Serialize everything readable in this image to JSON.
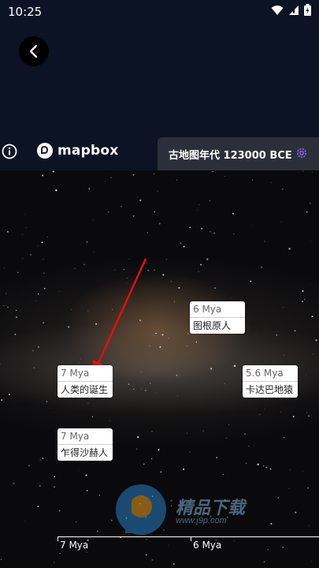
{
  "status_bar": {
    "time": "10:25"
  },
  "navigation": {
    "back_icon": "chevron-left-icon"
  },
  "map": {
    "info_icon": "info-icon",
    "provider": "mapbox",
    "era_label": "古地图年代 123000 BCE",
    "settings_icon": "gear-icon",
    "accent_color": "#8b5cf6"
  },
  "events": [
    {
      "date": "6 Mya",
      "name": "图根原人"
    },
    {
      "date": "7 Mya",
      "name": "人类的诞生"
    },
    {
      "date": "5.6 Mya",
      "name": "卡达巴地猿"
    },
    {
      "date": "7 Mya",
      "name": "乍得沙赫人"
    }
  ],
  "timeline": {
    "ticks": [
      "7 Mya",
      "6 Mya"
    ]
  },
  "watermark": {
    "text": "精品下载",
    "url": "www.j9p.com"
  }
}
